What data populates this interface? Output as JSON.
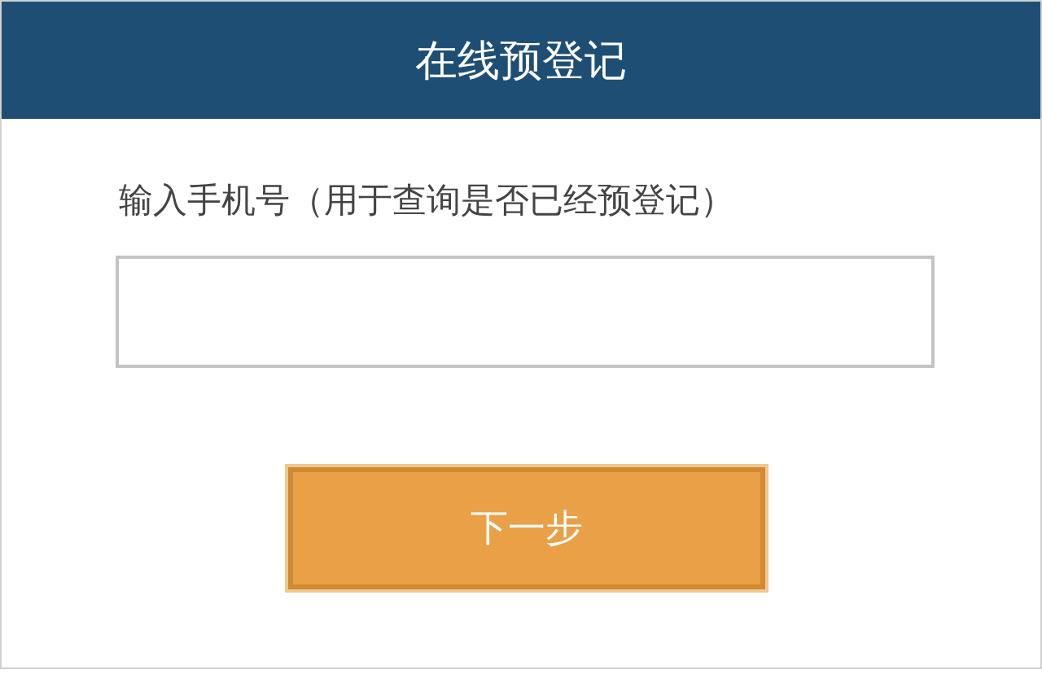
{
  "header": {
    "title": "在线预登记"
  },
  "form": {
    "label": "输入手机号（用于查询是否已经预登记）",
    "button": "下一步"
  }
}
